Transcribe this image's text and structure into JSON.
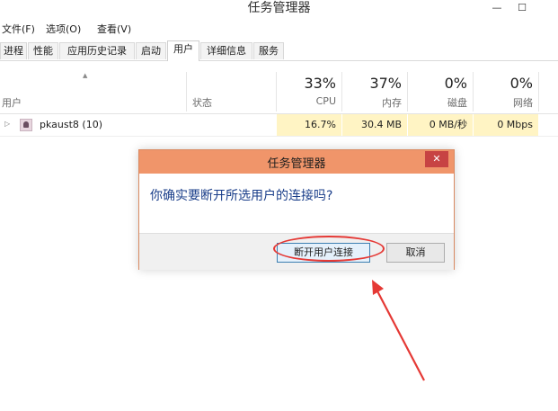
{
  "window": {
    "title": "任务管理器",
    "minimize_label": "—",
    "maximize_label": "☐"
  },
  "menubar": {
    "items": [
      "文件(F)",
      "选项(O)",
      "查看(V)"
    ]
  },
  "tabs": [
    "进程",
    "性能",
    "应用历史记录",
    "启动",
    "用户",
    "详细信息",
    "服务"
  ],
  "active_tab": "用户",
  "columns": {
    "user": "用户",
    "status": "状态",
    "cpu": {
      "percent": "33%",
      "label": "CPU"
    },
    "memory": {
      "percent": "37%",
      "label": "内存"
    },
    "disk": {
      "percent": "0%",
      "label": "磁盘"
    },
    "network": {
      "percent": "0%",
      "label": "网络"
    }
  },
  "rows": [
    {
      "name": "pkaust8 (10)",
      "status": "",
      "cpu": "16.7%",
      "memory": "30.4 MB",
      "disk": "0 MB/秒",
      "network": "0 Mbps"
    }
  ],
  "dialog": {
    "title": "任务管理器",
    "close_glyph": "✕",
    "message": "你确实要断开所选用户的连接吗?",
    "confirm_label": "断开用户连接",
    "cancel_label": "取消"
  },
  "colors": {
    "dialog_title_bg": "#f0956a",
    "dialog_border": "#d98a62",
    "close_button": "#c74343",
    "message_text": "#1a3e8a",
    "highlight_cell": "#fff4c4",
    "annotation_red": "#e53935"
  }
}
